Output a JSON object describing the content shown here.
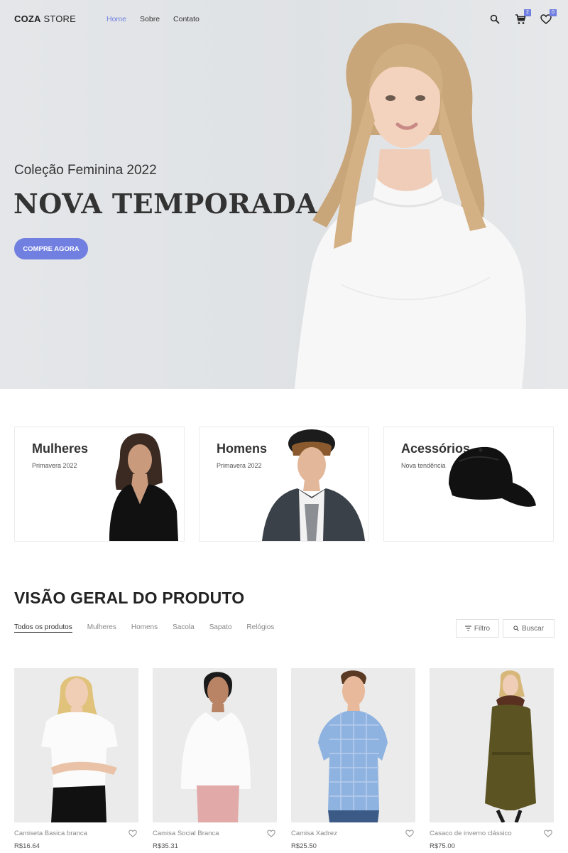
{
  "header": {
    "logo_bold": "COZA",
    "logo_light": "STORE",
    "nav": [
      "Home",
      "Sobre",
      "Contato"
    ],
    "cart_count": "2",
    "wishlist_count": "0",
    "icons": [
      "search-icon",
      "cart-icon",
      "heart-icon"
    ]
  },
  "hero": {
    "subtitle": "Coleção Feminina 2022",
    "title": "NOVA TEMPORADA",
    "button": "COMPRE AGORA"
  },
  "banners": [
    {
      "title": "Mulheres",
      "subtitle": "Primavera 2022"
    },
    {
      "title": "Homens",
      "subtitle": "Primavera 2022"
    },
    {
      "title": "Acessórios",
      "subtitle": "Nova tendência"
    }
  ],
  "overview": {
    "title": "VISÃO GERAL DO PRODUTO",
    "filters": [
      "Todos os produtos",
      "Mulheres",
      "Homens",
      "Sacola",
      "Sapato",
      "Relógios"
    ],
    "filter_button": "Filtro",
    "search_button": "Buscar"
  },
  "products": [
    {
      "name": "Camiseta Basica branca",
      "price": "R$16.64"
    },
    {
      "name": "Camisa Social Branca",
      "price": "R$35.31"
    },
    {
      "name": "Camisa Xadrez",
      "price": "R$25.50"
    },
    {
      "name": "Casaco de inverno clássico",
      "price": "R$75.00"
    }
  ],
  "colors": {
    "accent": "#717fe0",
    "text": "#333333",
    "hero_bg": "#e1e4e7"
  }
}
